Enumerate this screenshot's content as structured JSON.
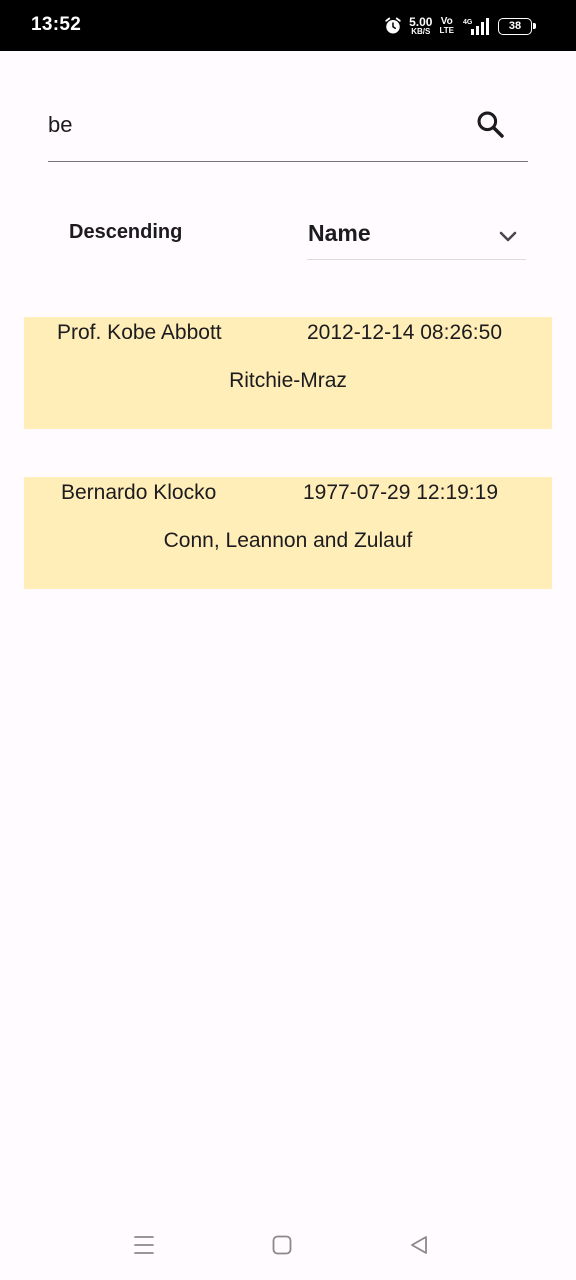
{
  "status_bar": {
    "time": "13:52",
    "speed_value": "5.00",
    "speed_unit": "KB/S",
    "volte_top": "Vo",
    "volte_bottom": "LTE",
    "network": "4G",
    "battery": "38"
  },
  "search": {
    "value": "be"
  },
  "sort": {
    "order_label": "Descending",
    "field_value": "Name"
  },
  "results": [
    {
      "name": "Prof. Kobe Abbott",
      "date": "2012-12-14 08:26:50",
      "company": "Ritchie-Mraz"
    },
    {
      "name": "Bernardo Klocko",
      "date": "1977-07-29 12:19:19",
      "company": "Conn, Leannon and Zulauf"
    }
  ],
  "colors": {
    "card_background": "#ffeeb8",
    "page_background": "#fffbfe",
    "status_bar": "#000000"
  },
  "icons": {
    "search": "search-icon",
    "dropdown": "chevron-down-icon",
    "nav_menu": "menu-icon",
    "nav_home": "home-square-icon",
    "nav_back": "back-triangle-icon"
  }
}
